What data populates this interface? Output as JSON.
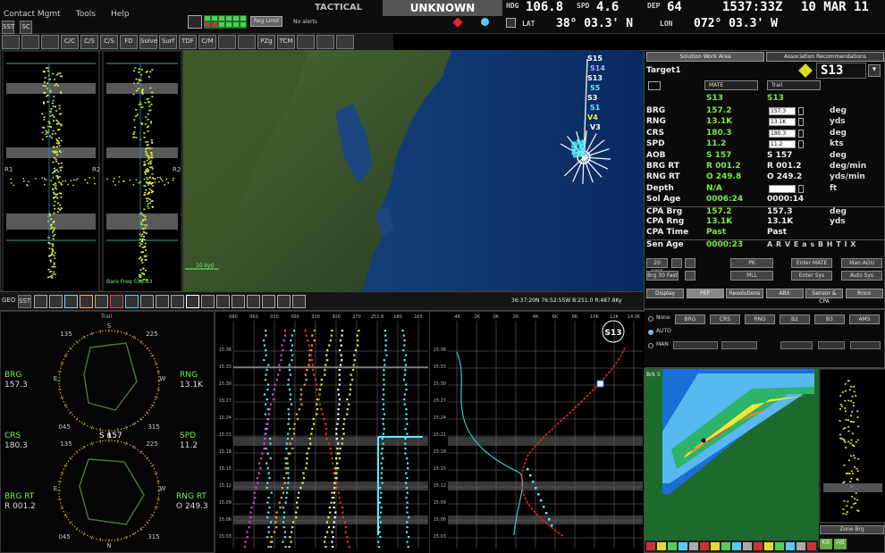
{
  "menu": [
    "Contact Mgmt",
    "Tools",
    "Help"
  ],
  "mode": "TACTICAL",
  "classification": "UNKNOWN",
  "nav": {
    "hdg_label": "HDG",
    "hdg": "106.8",
    "spd_label": "SPD",
    "spd": "4.6",
    "dep_label": "DEP",
    "dep": "64",
    "time": "1537:33Z",
    "date": "10 MAR 11",
    "lat_label": "LAT",
    "lat": "38° 03.3' N",
    "lon_label": "LON",
    "lon": "072° 03.3' W"
  },
  "toolbar": {
    "sst": "SST",
    "sc": "SC",
    "reg_label": "Reg Limit",
    "alerts": "No alerts",
    "buttons": [
      "",
      "",
      "",
      "C/C",
      "C/S",
      "C/S",
      "FD",
      "Solve",
      "Surf",
      "TDF",
      "C/M",
      "",
      "",
      "PZg",
      "TCM",
      "",
      "",
      ""
    ]
  },
  "strip": {
    "freq_left": "",
    "freq_right": "Bare Freq 558.63"
  },
  "map": {
    "scale": "10 kyd",
    "track_labels": [
      "S15",
      "S14",
      "S13",
      "S5",
      "S3",
      "S1",
      "V4",
      "V3"
    ]
  },
  "lower_toolbar": {
    "geo": "GEO",
    "sst": "SST",
    "readout": "36:37:20N 76:52:55W  B:251.0  R:487.8Ky"
  },
  "solution": {
    "tabs": [
      "Solution Work Area",
      "Association Recommendations"
    ],
    "target_label": "Target1",
    "track_id": "S13",
    "dropdowns": [
      "MATE",
      "Trail"
    ],
    "header": [
      "S13",
      "S13"
    ],
    "rows": [
      {
        "label": "BRG",
        "v1": "157.2",
        "v2": "157.3",
        "unit": "deg"
      },
      {
        "label": "RNG",
        "v1": "13.1K",
        "v2": "13.1K",
        "unit": "yds"
      },
      {
        "label": "CRS",
        "v1": "180.3",
        "v2": "180.3",
        "unit": "deg"
      },
      {
        "label": "SPD",
        "v1": "11.2",
        "v2": "11.2",
        "unit": "kts"
      },
      {
        "label": "AOB",
        "v1": "S 157",
        "v2": "S 157",
        "unit": "deg"
      },
      {
        "label": "BRG RT",
        "v1": "R 001.2",
        "v2": "R 001.2",
        "unit": "deg/min"
      },
      {
        "label": "RNG RT",
        "v1": "O 249.8",
        "v2": "O 249.2",
        "unit": "yds/min"
      },
      {
        "label": "Depth",
        "v1": "N/A",
        "v2": "",
        "unit": "ft"
      },
      {
        "label": "Sol Age",
        "v1": "0006:24",
        "v2": "0000:14",
        "unit": ""
      },
      {
        "label": "CPA Brg",
        "v1": "157.2",
        "v2": "157.3",
        "unit": "deg"
      },
      {
        "label": "CPA Rng",
        "v1": "13.1K",
        "v2": "13.1K",
        "unit": "yds"
      },
      {
        "label": "CPA Time",
        "v1": "Past",
        "v2": "Past",
        "unit": ""
      },
      {
        "label": "Sen Age",
        "v1": "0000:23",
        "v2": "A R V E a s B H T I X",
        "unit": ""
      }
    ],
    "buttons_row1": [
      "20 secs",
      "PK",
      "Enter MATE",
      "Man AOU"
    ],
    "buttons_row2": [
      "Brg 30 Fast",
      "MLL",
      "Enter Sys",
      "Auto Sys"
    ],
    "bottom_tabs": [
      "Display",
      "PEP",
      "Resolutions",
      "ABX",
      "Sensor & CPA",
      "Rnco"
    ],
    "chips": [
      "None",
      "BRG",
      "CRS",
      "RNG",
      "B2",
      "B3",
      "AMS"
    ],
    "auto": "AUTO",
    "man": "MAN"
  },
  "polar": {
    "top_label": "Trail",
    "brg_label": "BRG",
    "brg": "157.3",
    "rng_label": "RNG",
    "rng": "13.1K",
    "crs_label": "CRS",
    "crs": "180.3",
    "center": "S 157",
    "spd_label": "SPD",
    "spd": "11.2",
    "brgrt_label": "BRG RT",
    "brgrt": "R 001.2",
    "rngrt_label": "RNG RT",
    "rngrt": "O 249.3",
    "compass_top": [
      "135",
      "S",
      "225"
    ],
    "compass_side": [
      "E",
      "W"
    ],
    "compass_bot": [
      "045",
      "N",
      "315"
    ]
  },
  "waterfall": {
    "top_ticks": [
      "090",
      "060",
      "030",
      "000",
      "330",
      "300",
      "270",
      "251.8",
      "180",
      "165"
    ],
    "time_ticks": [
      "15:36",
      "15:33",
      "15:30",
      "15:27",
      "15:24",
      "15:21",
      "15:18",
      "15:15",
      "15:12",
      "15:09",
      "15:06",
      "15:03"
    ]
  },
  "range_plot": {
    "top_ticks": [
      "-4K",
      "-2K",
      "0K",
      "2K",
      "4K",
      "6K",
      "8K",
      "10K",
      "12K",
      "14.0K"
    ],
    "time_ticks": [
      "15:36",
      "15:33",
      "15:30",
      "15:27",
      "15:24",
      "15:21",
      "15:18",
      "15:15",
      "15:12",
      "15:09",
      "15:06",
      "15:03"
    ],
    "badge": "S13"
  },
  "heatmap": {
    "corner": "Brk S",
    "right_label": "Zone Brg",
    "bottom_btns": [
      "KB",
      "AB"
    ]
  },
  "colors": {
    "green": "#7fe94a",
    "cyan": "#5ff",
    "ocean": "#0d3a7a",
    "land": "#3d5a28"
  }
}
